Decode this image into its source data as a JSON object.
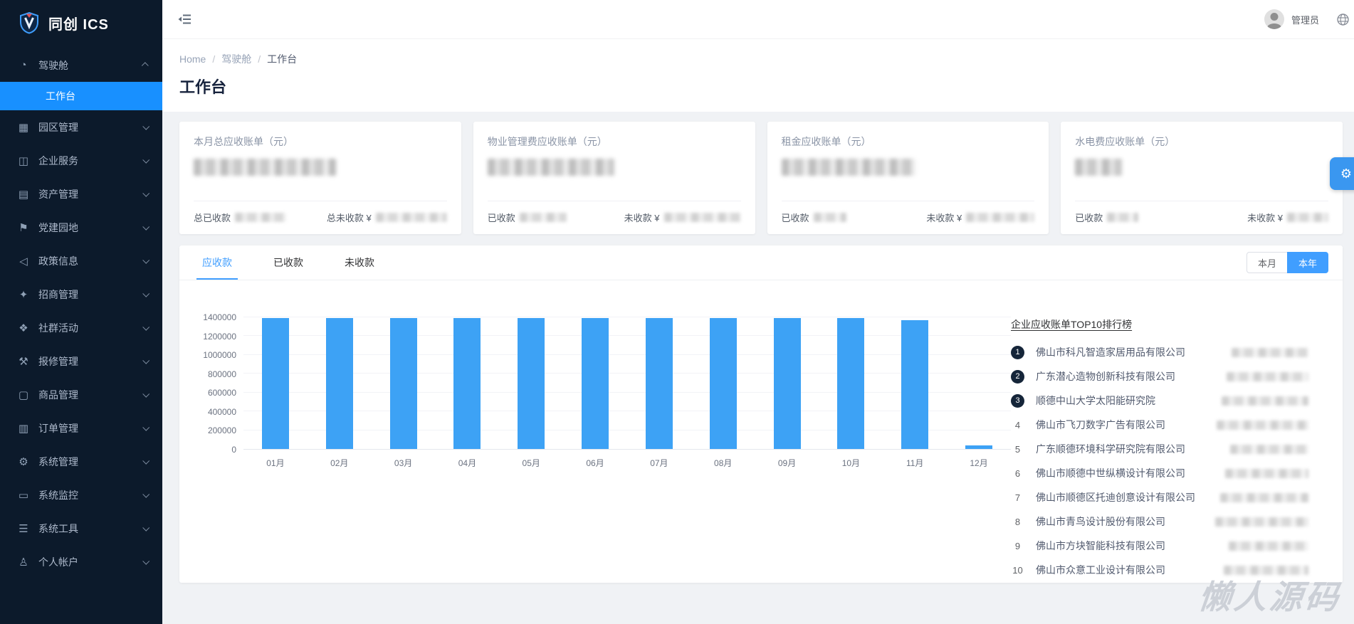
{
  "app": {
    "logo_text": "同创 ICS",
    "logo_icon": "shield-icon"
  },
  "header": {
    "fold_icon": "fold-sidebar-icon",
    "admin_name": "管理员",
    "avatar_icon": "user-avatar",
    "lang_icon": "globe-icon"
  },
  "sidebar": {
    "items": [
      {
        "id": "dashboard",
        "label": "驾驶舱",
        "icon": "dashboard-icon",
        "glyph": "◔",
        "expanded": true,
        "children": [
          {
            "id": "workbench",
            "label": "工作台",
            "active": true
          }
        ]
      },
      {
        "id": "park",
        "label": "园区管理",
        "icon": "park-icon",
        "glyph": "▦"
      },
      {
        "id": "enterprise",
        "label": "企业服务",
        "icon": "enterprise-icon",
        "glyph": "◫"
      },
      {
        "id": "asset",
        "label": "资产管理",
        "icon": "asset-icon",
        "glyph": "▤"
      },
      {
        "id": "party",
        "label": "党建园地",
        "icon": "party-icon",
        "glyph": "⚑"
      },
      {
        "id": "policy",
        "label": "政策信息",
        "icon": "policy-icon",
        "glyph": "◁"
      },
      {
        "id": "investment",
        "label": "招商管理",
        "icon": "investment-icon",
        "glyph": "✦"
      },
      {
        "id": "community",
        "label": "社群活动",
        "icon": "community-icon",
        "glyph": "❖"
      },
      {
        "id": "repair",
        "label": "报修管理",
        "icon": "repair-icon",
        "glyph": "⚒"
      },
      {
        "id": "goods",
        "label": "商品管理",
        "icon": "goods-icon",
        "glyph": "▢"
      },
      {
        "id": "order",
        "label": "订单管理",
        "icon": "order-icon",
        "glyph": "▥"
      },
      {
        "id": "system",
        "label": "系统管理",
        "icon": "system-icon",
        "glyph": "⚙"
      },
      {
        "id": "monitor",
        "label": "系统监控",
        "icon": "monitor-icon",
        "glyph": "▭"
      },
      {
        "id": "tools",
        "label": "系统工具",
        "icon": "tools-icon",
        "glyph": "☰"
      },
      {
        "id": "account",
        "label": "个人帐户",
        "icon": "account-icon",
        "glyph": "♙"
      }
    ]
  },
  "breadcrumb": {
    "separator": "/",
    "items": [
      "Home",
      "驾驶舱",
      "工作台"
    ]
  },
  "page": {
    "title": "工作台"
  },
  "stat_cards": [
    {
      "id": "month_total",
      "title": "本月总应收账单（元）",
      "footer_left": "总已收款",
      "footer_right": "总未收款 ¥",
      "redacted": {
        "value_w": 200,
        "left_w": 72,
        "right_w": 100
      }
    },
    {
      "id": "property",
      "title": "物业管理费应收账单（元）",
      "footer_left": "已收款",
      "footer_right": "未收款 ¥",
      "redacted": {
        "value_w": 178,
        "left_w": 66,
        "right_w": 108
      }
    },
    {
      "id": "rent",
      "title": "租金应收账单（元）",
      "footer_left": "已收款",
      "footer_right": "未收款 ¥",
      "redacted": {
        "value_w": 188,
        "left_w": 46,
        "right_w": 96
      }
    },
    {
      "id": "utility",
      "title": "水电费应收账单（元）",
      "footer_left": "已收款",
      "footer_right": "未收款 ¥",
      "redacted": {
        "value_w": 66,
        "left_w": 44,
        "right_w": 58
      }
    }
  ],
  "tabs": [
    {
      "id": "receivable",
      "label": "应收款",
      "active": true
    },
    {
      "id": "received",
      "label": "已收款",
      "active": false
    },
    {
      "id": "unpaid",
      "label": "未收款",
      "active": false
    }
  ],
  "period_buttons": [
    {
      "id": "month",
      "label": "本月",
      "active": false
    },
    {
      "id": "year",
      "label": "本年",
      "active": true
    }
  ],
  "chart_data": {
    "type": "bar",
    "title": "",
    "categories": [
      "01月",
      "02月",
      "03月",
      "04月",
      "05月",
      "06月",
      "07月",
      "08月",
      "09月",
      "10月",
      "11月",
      "12月"
    ],
    "values": [
      1390000,
      1390000,
      1390000,
      1390000,
      1390000,
      1390000,
      1390000,
      1390000,
      1390000,
      1390000,
      1370000,
      40000
    ],
    "xlabel": "",
    "ylabel": "",
    "ylim": [
      0,
      1400000
    ],
    "yticks": [
      0,
      200000,
      400000,
      600000,
      800000,
      1000000,
      1200000,
      1400000
    ],
    "grid": true,
    "legend_position": "none",
    "bar_color": "#3da2f5"
  },
  "top10": {
    "title": "企业应收账单TOP10排行榜",
    "items": [
      {
        "rank": 1,
        "name": "佛山市科凡智造家居用品有限公司"
      },
      {
        "rank": 2,
        "name": "广东潜心造物创新科技有限公司"
      },
      {
        "rank": 3,
        "name": "顺德中山大学太阳能研究院"
      },
      {
        "rank": 4,
        "name": "佛山市飞刀数字广告有限公司"
      },
      {
        "rank": 5,
        "name": "广东顺德环境科学研究院有限公司"
      },
      {
        "rank": 6,
        "name": "佛山市顺德中世纵横设计有限公司"
      },
      {
        "rank": 7,
        "name": "佛山市顺德区托迪创意设计有限公司"
      },
      {
        "rank": 8,
        "name": "佛山市青鸟设计股份有限公司"
      },
      {
        "rank": 9,
        "name": "佛山市方块智能科技有限公司"
      },
      {
        "rank": 10,
        "name": "佛山市众意工业设计有限公司"
      }
    ]
  },
  "floating": {
    "settings_icon": "gear-icon",
    "settings_glyph": "⚙"
  },
  "watermark": "懒人源码",
  "colors": {
    "accent": "#409eff",
    "sidebar_bg": "#0c1a2b",
    "active_menu": "#1890ff",
    "bar": "#3da2f5",
    "page_bg": "#f0f2f5"
  }
}
